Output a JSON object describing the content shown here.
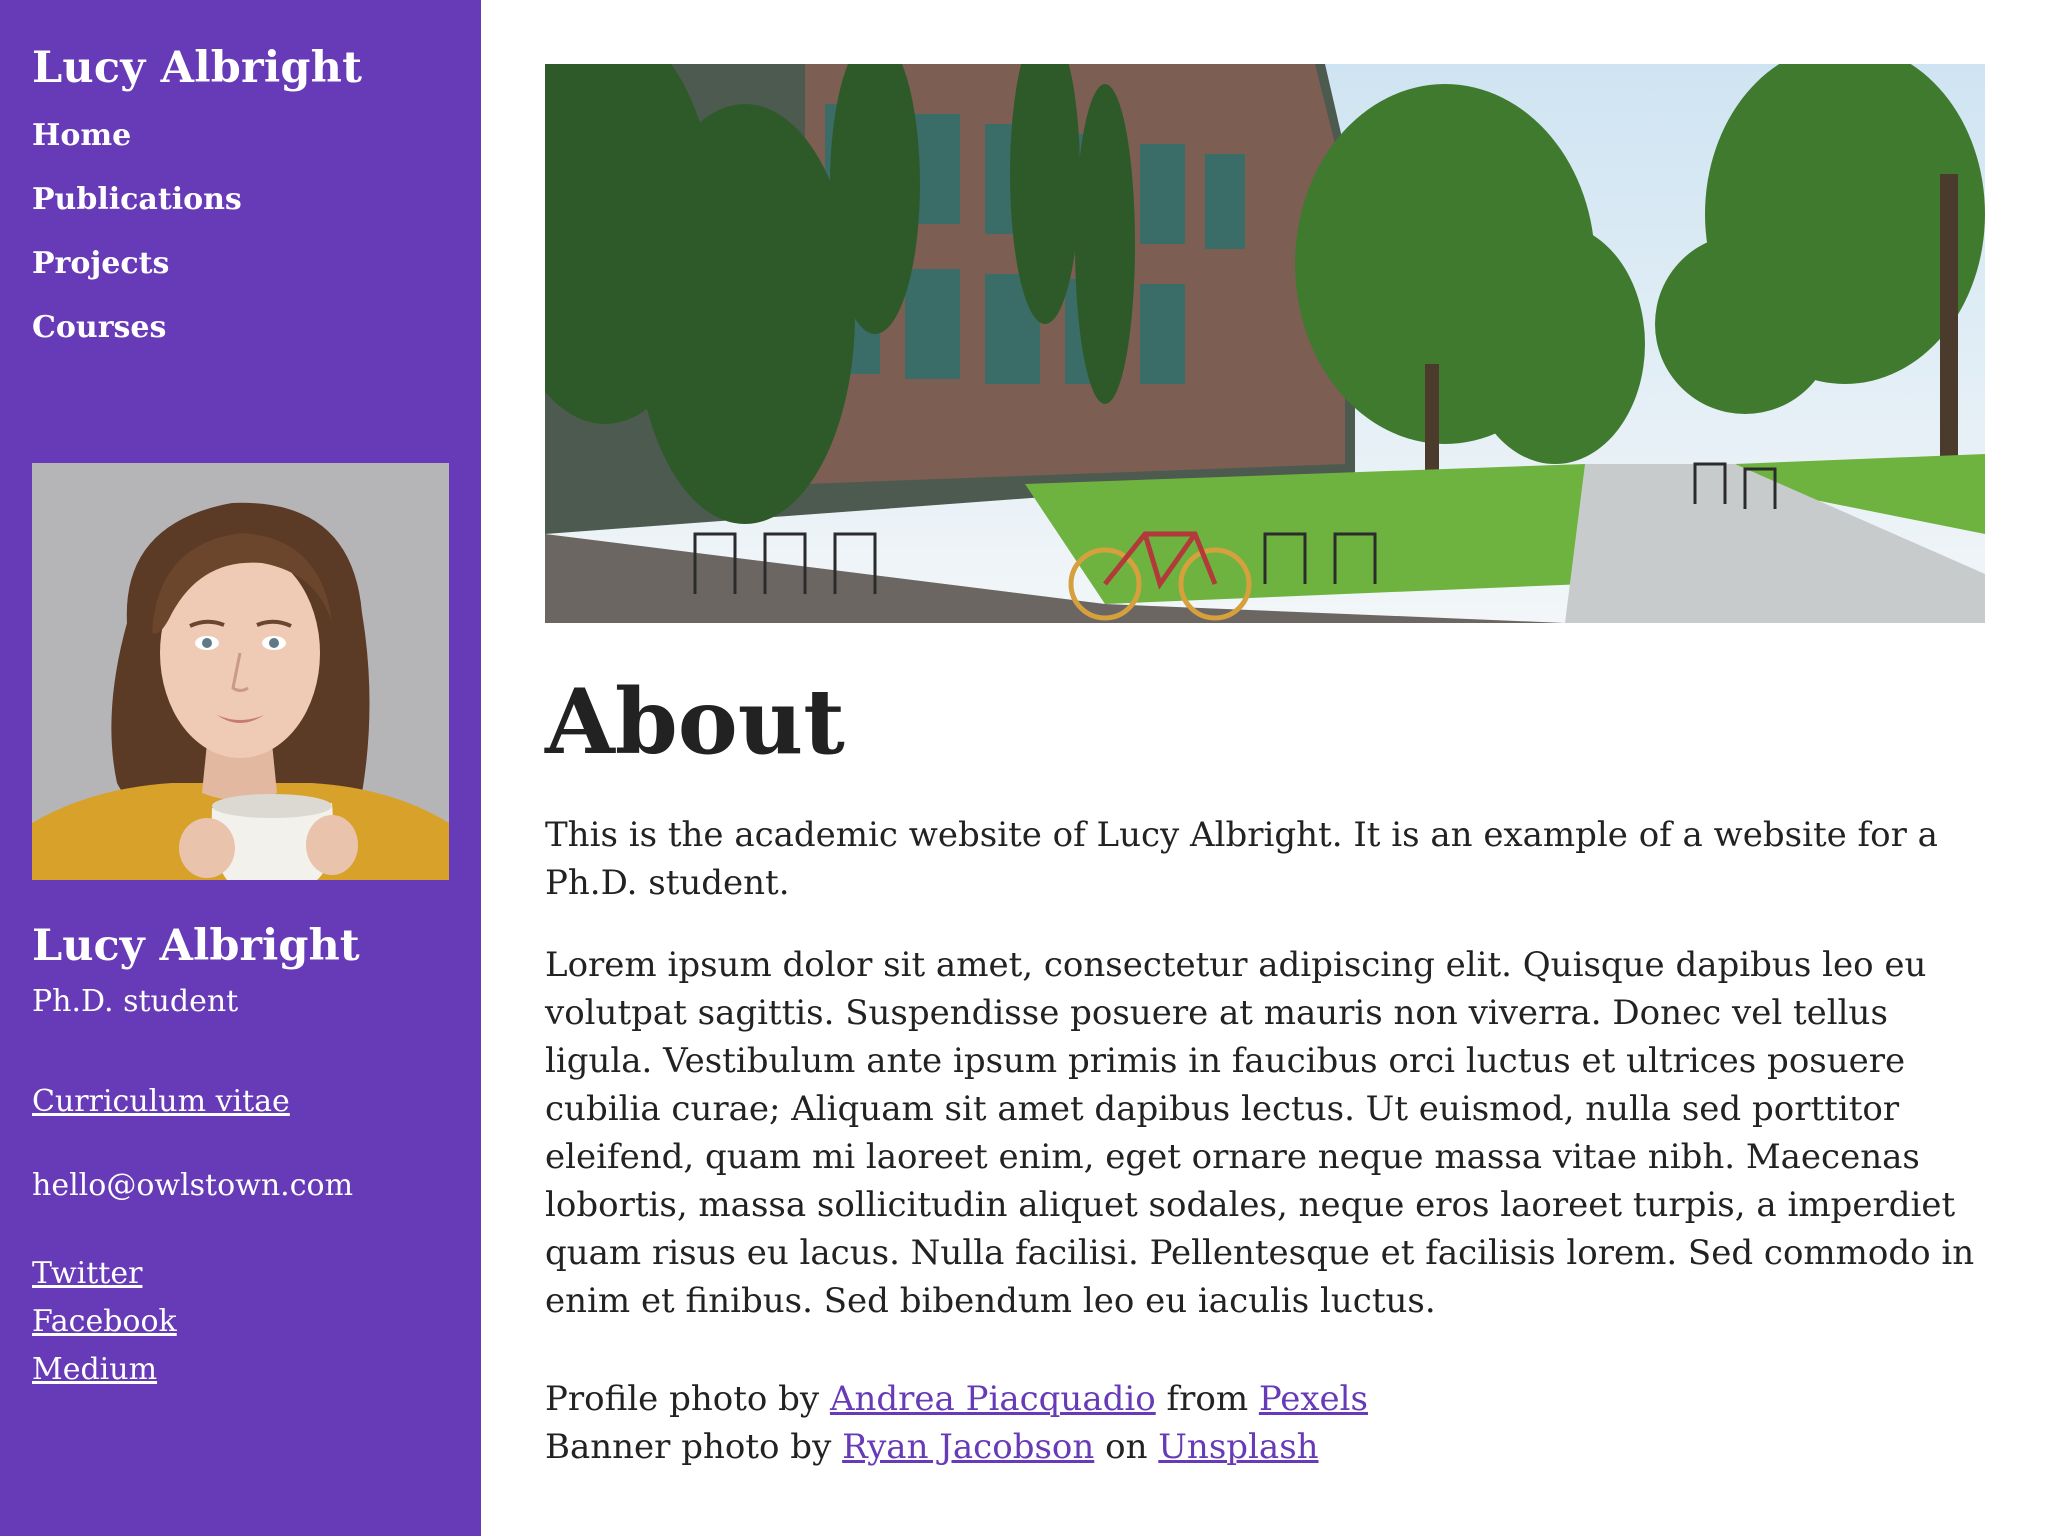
{
  "sidebar": {
    "site_title": "Lucy Albright",
    "nav": [
      {
        "label": "Home"
      },
      {
        "label": "Publications"
      },
      {
        "label": "Projects"
      },
      {
        "label": "Courses"
      }
    ],
    "profile": {
      "name": "Lucy Albright",
      "role": "Ph.D. student",
      "cv_link": "Curriculum vitae",
      "email": "hello@owlstown.com",
      "social": [
        {
          "label": "Twitter"
        },
        {
          "label": "Facebook"
        },
        {
          "label": "Medium"
        }
      ]
    },
    "background_color": "#673ab7"
  },
  "main": {
    "title": "About",
    "intro": "This is the academic website of Lucy Albright. It is an example of a website for a Ph.D. student.",
    "body": "Lorem ipsum dolor sit amet, consectetur adipiscing elit. Quisque dapibus leo eu volutpat sagittis. Suspendisse posuere at mauris non viverra. Donec vel tellus ligula. Vestibulum ante ipsum primis in faucibus orci luctus et ultrices posuere cubilia curae; Aliquam sit amet dapibus lectus. Ut euismod, nulla sed porttitor eleifend, quam mi laoreet enim, eget ornare neque massa vitae nibh. Maecenas lobortis, massa sollicitudin aliquet sodales, neque eros laoreet turpis, a imperdiet quam risus eu lacus. Nulla facilisi. Pellentesque et facilisis lorem. Sed commodo in enim et finibus. Sed bibendum leo eu iaculis luctus.",
    "credits": {
      "profile_prefix": "Profile photo by",
      "profile_author": "Andrea Piacquadio",
      "profile_mid": "from",
      "profile_source": "Pexels",
      "banner_prefix": "Banner photo by",
      "banner_author": "Ryan Jacobson",
      "banner_mid": "on",
      "banner_source": "Unsplash"
    },
    "link_color": "#673ab7"
  }
}
